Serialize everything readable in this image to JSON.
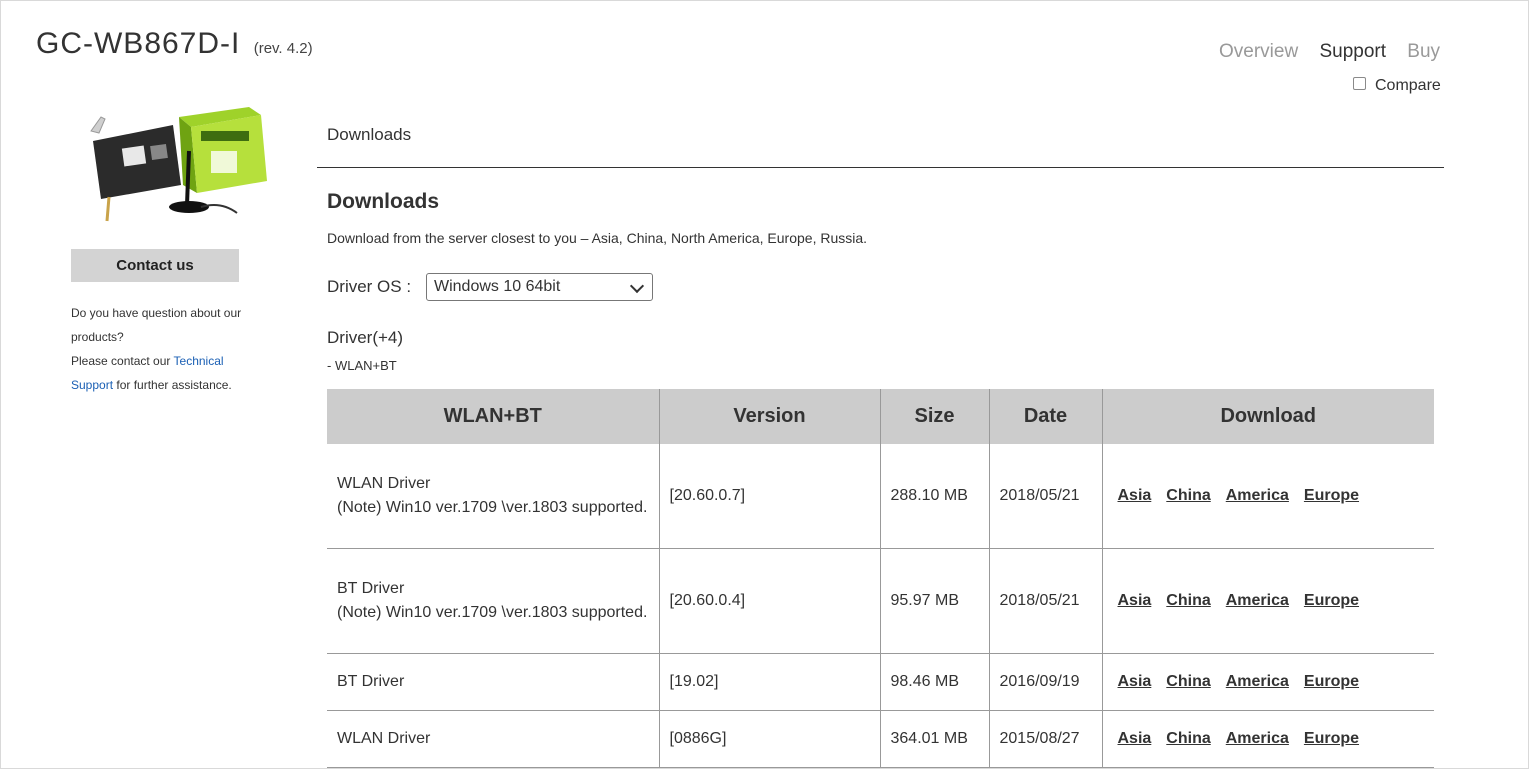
{
  "product": {
    "name": "GC-WB867D-I",
    "revision": "(rev. 4.2)"
  },
  "topnav": [
    "Overview",
    "Support",
    "Buy"
  ],
  "compare_label": "Compare",
  "sidebar": {
    "contact_button": "Contact us",
    "help_line1": "Do you have question about our products?",
    "help_line2_pre": "Please contact our ",
    "help_link": "Technical Support",
    "help_line2_post": " for further assistance."
  },
  "section_tab": "Downloads",
  "downloads": {
    "heading": "Downloads",
    "description": "Download from the server closest to you – Asia, China, North America, Europe, Russia.",
    "os_label": "Driver OS :",
    "os_selected": "Windows 10 64bit",
    "driver_title": "Driver(+4)",
    "driver_sub": "- WLAN+BT"
  },
  "table": {
    "headers": [
      "WLAN+BT",
      "Version",
      "Size",
      "Date",
      "Download"
    ],
    "rows": [
      {
        "name": "WLAN Driver",
        "note": "(Note) Win10 ver.1709 \\ver.1803 supported.",
        "version": "[20.60.0.7]",
        "size": "288.10 MB",
        "date": "2018/05/21"
      },
      {
        "name": "BT Driver",
        "note": "(Note) Win10 ver.1709 \\ver.1803 supported.",
        "version": "[20.60.0.4]",
        "size": "95.97 MB",
        "date": "2018/05/21"
      },
      {
        "name": "BT Driver",
        "note": "",
        "version": "[19.02]",
        "size": "98.46 MB",
        "date": "2016/09/19"
      },
      {
        "name": "WLAN Driver",
        "note": "",
        "version": "[0886G]",
        "size": "364.01 MB",
        "date": "2015/08/27"
      }
    ],
    "download_links": [
      "Asia",
      "China",
      "America",
      "Europe"
    ]
  }
}
